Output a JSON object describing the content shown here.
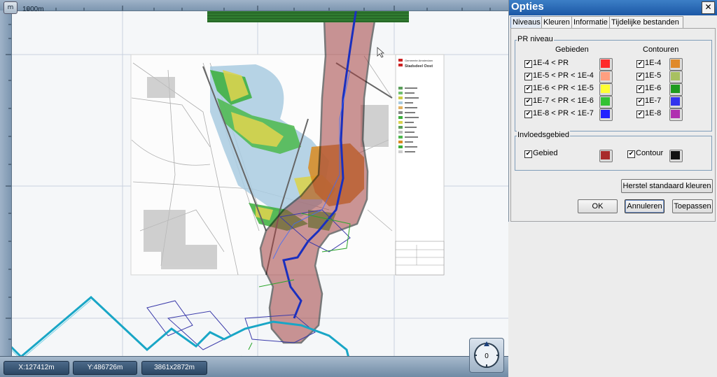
{
  "map": {
    "scale_button": "m",
    "scale_label": "1000m",
    "legend_org": "Gemeente Amsterdam",
    "legend_district": "Stadsdeel Oost"
  },
  "status": {
    "x": "X:127412m",
    "y": "Y:486726m",
    "size": "3861x2872m"
  },
  "compass": {
    "value": "0"
  },
  "dialog": {
    "title": "Opties",
    "close": "✕",
    "tabs": [
      "Niveaus",
      "Kleuren",
      "Informatie",
      "Tijdelijke bestanden"
    ],
    "active_tab": "Niveaus",
    "pr_group": {
      "title": "PR niveau",
      "col_areas": "Gebieden",
      "col_contours": "Contouren",
      "areas": [
        {
          "label": "1E-4 < PR",
          "checked": "✔",
          "color": "#ff2a2a"
        },
        {
          "label": "1E-5 < PR < 1E-4",
          "checked": "✔",
          "color": "#ff9f80"
        },
        {
          "label": "1E-6 < PR < 1E-5",
          "checked": "✔",
          "color": "#ffff33"
        },
        {
          "label": "1E-7 < PR < 1E-6",
          "checked": "✔",
          "color": "#33c233"
        },
        {
          "label": "1E-8 < PR < 1E-7",
          "checked": "✔",
          "color": "#2222ff"
        }
      ],
      "contours": [
        {
          "label": "1E-4",
          "checked": "✔",
          "color": "#e08a2a"
        },
        {
          "label": "1E-5",
          "checked": "✔",
          "color": "#a8c060"
        },
        {
          "label": "1E-6",
          "checked": "✔",
          "color": "#1e9b1e"
        },
        {
          "label": "1E-7",
          "checked": "✔",
          "color": "#3333ee"
        },
        {
          "label": "1E-8",
          "checked": "✔",
          "color": "#b030b0"
        }
      ]
    },
    "influence_group": {
      "title": "Invloedsgebied",
      "area_label": "Gebied",
      "area_checked": "✔",
      "area_color": "#a82a2a",
      "contour_label": "Contour",
      "contour_checked": "✔",
      "contour_color": "#111111"
    },
    "reset_button": "Herstel standaard kleuren",
    "ok_button": "OK",
    "cancel_button": "Annuleren",
    "apply_button": "Toepassen"
  }
}
